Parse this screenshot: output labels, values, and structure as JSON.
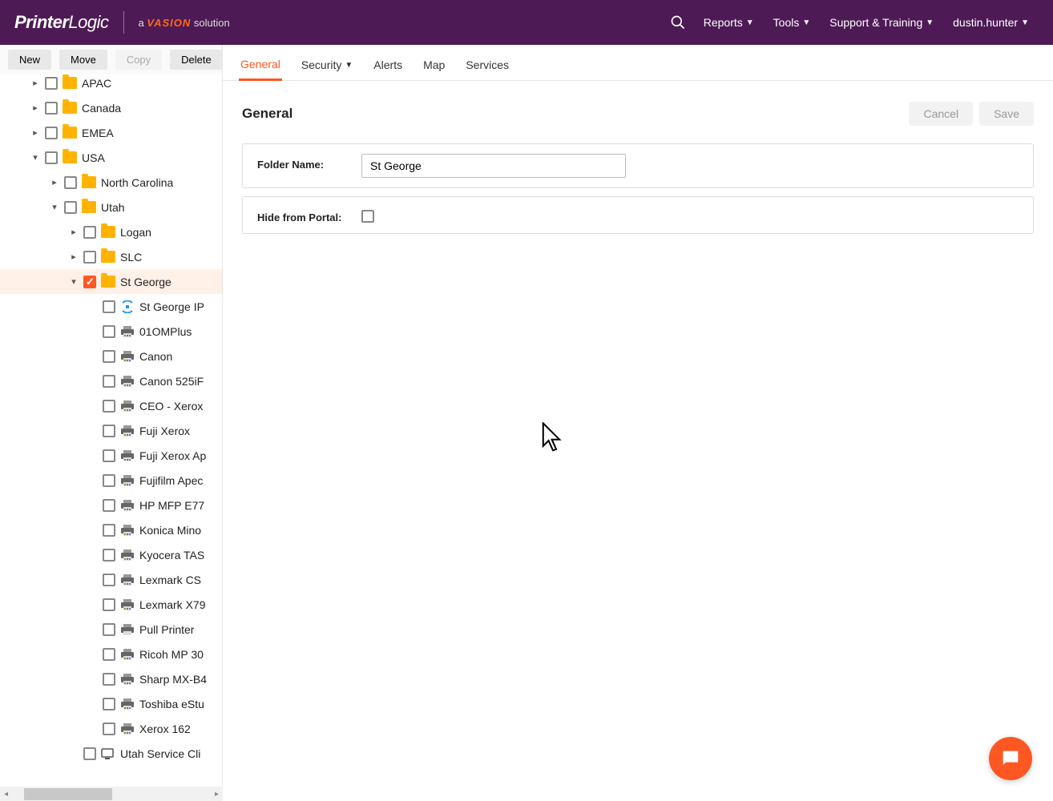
{
  "header": {
    "logo_bold": "Printer",
    "logo_light": "Logic",
    "tagline_prefix": "a ",
    "tagline_brand": "VASION",
    "tagline_suffix": " solution",
    "menu": {
      "reports": "Reports",
      "tools": "Tools",
      "support": "Support & Training",
      "user": "dustin.hunter"
    }
  },
  "toolbar": {
    "new": "New",
    "move": "Move",
    "copy": "Copy",
    "delete": "Delete"
  },
  "tree": {
    "apac": "APAC",
    "canada": "Canada",
    "emea": "EMEA",
    "usa": "USA",
    "nc": "North Carolina",
    "utah": "Utah",
    "logan": "Logan",
    "slc": "SLC",
    "stgeorge": "St George",
    "items": [
      "St George IP",
      "01OMPlus",
      "Canon",
      "Canon 525iF",
      "CEO - Xerox",
      "Fuji Xerox",
      "Fuji Xerox Ap",
      "Fujifilm Apec",
      "HP MFP E77",
      "Konica Mino",
      "Kyocera TAS",
      "Lexmark CS",
      "Lexmark X79",
      "Pull Printer",
      "Ricoh MP 30",
      "Sharp MX-B4",
      "Toshiba eStu",
      "Xerox 162"
    ],
    "utah_client": "Utah Service Cli"
  },
  "tabs": {
    "general": "General",
    "security": "Security",
    "alerts": "Alerts",
    "map": "Map",
    "services": "Services"
  },
  "section": {
    "title": "General",
    "cancel": "Cancel",
    "save": "Save"
  },
  "form": {
    "folder_label": "Folder Name:",
    "folder_value": "St George",
    "hide_label": "Hide from Portal:"
  }
}
